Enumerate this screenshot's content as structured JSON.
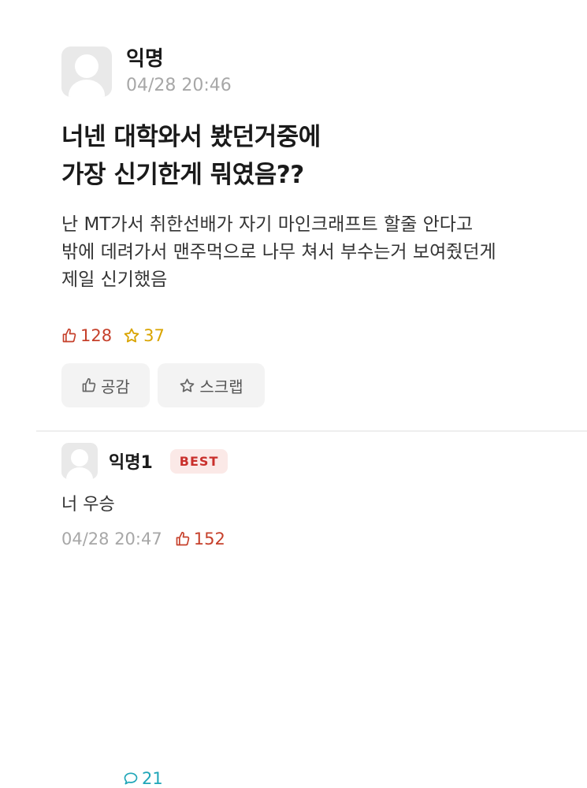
{
  "post": {
    "author": "익명",
    "time": "04/28 20:46",
    "title_lines": [
      "너넨 대학와서 봤던거중에",
      "가장 신기한게 뭐였음??"
    ],
    "body_lines": [
      "난 MT가서 취한선배가 자기 마인크래프트 할줄 안다고",
      "밖에 데려가서 맨주먹으로 나무 쳐서 부수는거 보여줬던게",
      "제일 신기했음"
    ],
    "stats": {
      "likes": "128",
      "comments": "21",
      "scraps": "37"
    },
    "actions": {
      "like_label": "공감",
      "scrap_label": "스크랩"
    }
  },
  "comment": {
    "author": "익명1",
    "badge": "BEST",
    "text": "너 우승",
    "time": "04/28 20:47",
    "likes": "152"
  },
  "colors": {
    "like": "#c6402b",
    "comment": "#1fa6b8",
    "scrap": "#d9a400",
    "badge_bg": "#fbe9e7",
    "badge_text": "#c9302c"
  },
  "icons": {
    "like": "thumbs-up-icon",
    "comment": "speech-bubble-icon",
    "scrap": "star-icon"
  }
}
